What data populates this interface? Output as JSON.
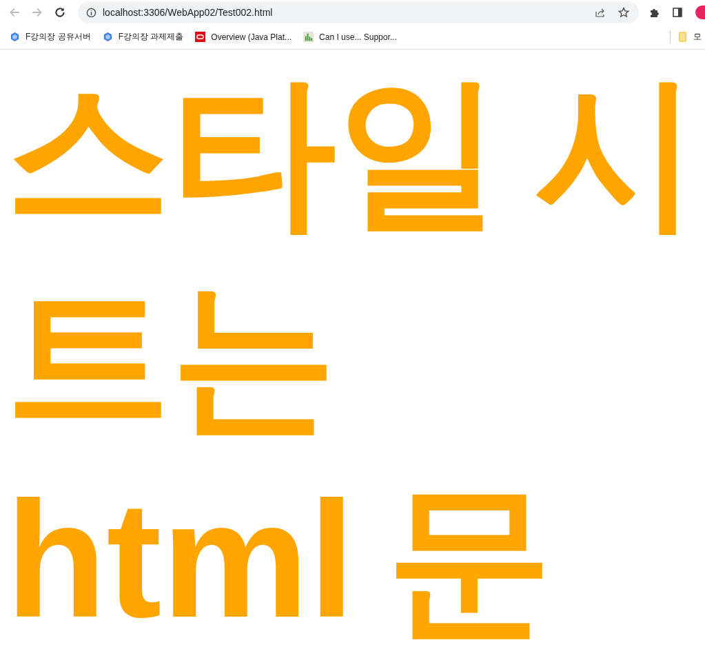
{
  "browser": {
    "url": "localhost:3306/WebApp02/Test002.html",
    "bookmarks": [
      {
        "label": "F강의장 공유서버",
        "kind": "cube"
      },
      {
        "label": "F강의장 과제제출",
        "kind": "cube"
      },
      {
        "label": "Overview (Java Plat...",
        "kind": "oracle"
      },
      {
        "label": "Can I use... Suppor...",
        "kind": "chart"
      }
    ],
    "other_bookmarks": "모"
  },
  "page": {
    "heading": "스타일 시트는 html 문"
  }
}
